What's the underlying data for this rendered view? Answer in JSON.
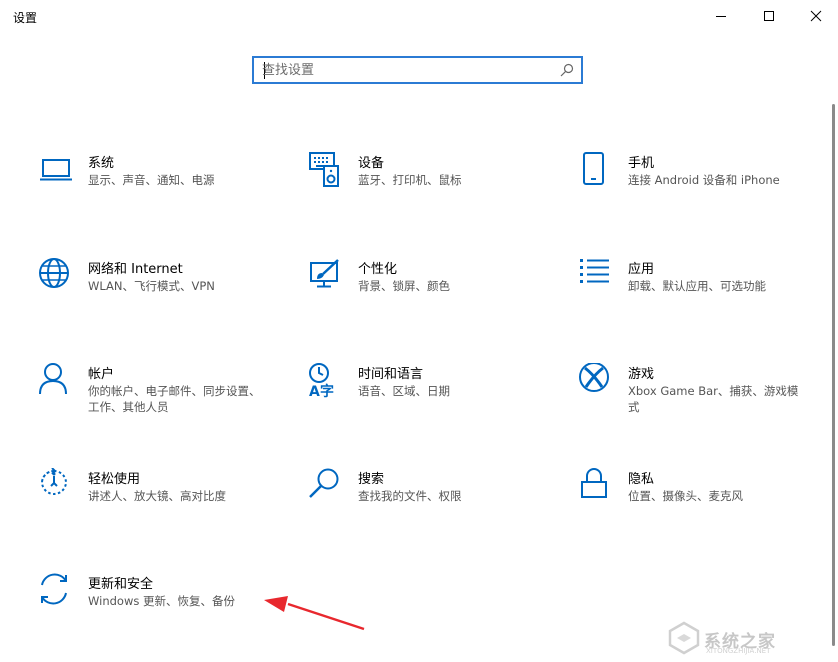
{
  "window": {
    "title": "设置",
    "controls": {
      "minimize": "minimize-icon",
      "maximize": "maximize-icon",
      "close": "close-icon"
    }
  },
  "search": {
    "placeholder": "查找设置",
    "value": ""
  },
  "accent_color": "#0067c0",
  "categories": [
    {
      "title": "系统",
      "desc": "显示、声音、通知、电源",
      "icon": "laptop-icon"
    },
    {
      "title": "设备",
      "desc": "蓝牙、打印机、鼠标",
      "icon": "devices-icon"
    },
    {
      "title": "手机",
      "desc": "连接 Android 设备和 iPhone",
      "icon": "phone-icon"
    },
    {
      "title": "网络和 Internet",
      "desc": "WLAN、飞行模式、VPN",
      "icon": "globe-icon"
    },
    {
      "title": "个性化",
      "desc": "背景、锁屏、颜色",
      "icon": "paint-brush-icon"
    },
    {
      "title": "应用",
      "desc": "卸载、默认应用、可选功能",
      "icon": "apps-list-icon"
    },
    {
      "title": "帐户",
      "desc": "你的帐户、电子邮件、同步设置、工作、其他人员",
      "icon": "person-icon"
    },
    {
      "title": "时间和语言",
      "desc": "语音、区域、日期",
      "icon": "time-language-icon"
    },
    {
      "title": "游戏",
      "desc": "Xbox Game Bar、捕获、游戏模式",
      "icon": "xbox-icon"
    },
    {
      "title": "轻松使用",
      "desc": "讲述人、放大镜、高对比度",
      "icon": "ease-of-access-icon"
    },
    {
      "title": "搜索",
      "desc": "查找我的文件、权限",
      "icon": "search-icon"
    },
    {
      "title": "隐私",
      "desc": "位置、摄像头、麦克风",
      "icon": "lock-icon"
    },
    {
      "title": "更新和安全",
      "desc": "Windows 更新、恢复、备份",
      "icon": "sync-icon"
    }
  ],
  "watermark": {
    "text": "系统之家",
    "url": "XITONGZHIJIA.NET"
  }
}
